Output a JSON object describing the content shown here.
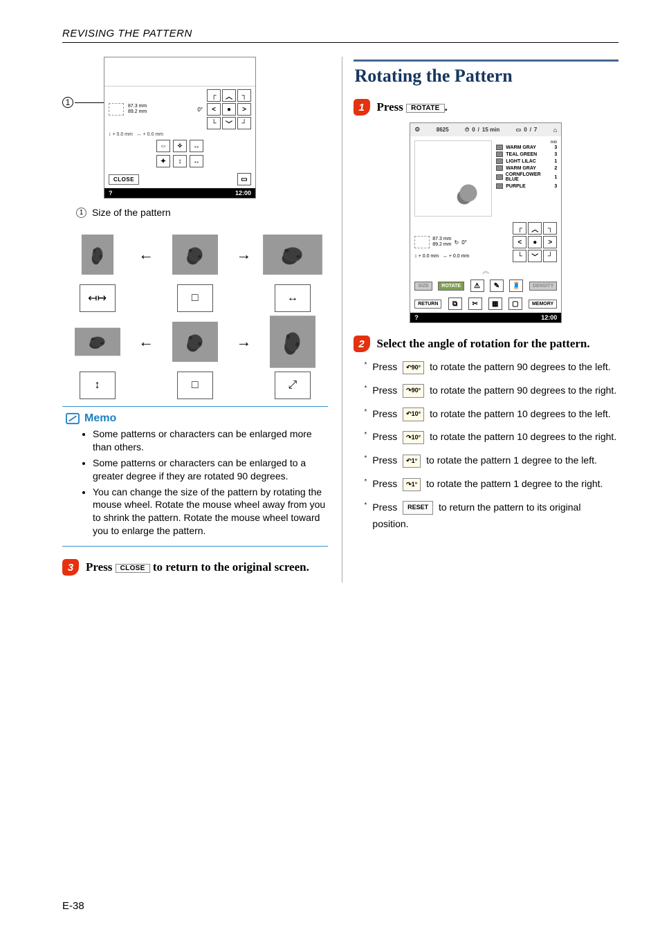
{
  "header": "REVISING THE PATTERN",
  "left": {
    "lcd_top": {
      "dims_h": "87.3 mm",
      "dims_w": "89.2 mm",
      "angle": "0°",
      "offset_v": "0.0 mm",
      "offset_h": "0.0 mm",
      "close_label": "CLOSE",
      "time": "12:00"
    },
    "callout_1": "1",
    "legend_1": "Size of the pattern",
    "memo": {
      "title": "Memo",
      "items": [
        "Some patterns or characters can be enlarged more than others.",
        "Some patterns or characters can be enlarged to a greater degree if they are rotated 90 degrees.",
        "You can change the size of the pattern by rotating the mouse wheel. Rotate the mouse wheel away from you to shrink the pattern. Rotate the mouse wheel toward you to enlarge the pattern."
      ]
    },
    "step3": {
      "num": "3",
      "pre": "Press ",
      "btn": "CLOSE",
      "post": " to return to the original screen."
    }
  },
  "right": {
    "heading": "Rotating the Pattern",
    "step1": {
      "num": "1",
      "pre": "Press ",
      "btn": "ROTATE",
      "post": "."
    },
    "lcd": {
      "stitch_count": "8625",
      "time_min": "0",
      "time_total": "15 min",
      "color_cur": "0",
      "color_total": "7",
      "threads_label": "min",
      "threads": [
        {
          "name": "WARM GRAY",
          "min": "3"
        },
        {
          "name": "TEAL GREEN",
          "min": "3"
        },
        {
          "name": "LIGHT LILAC",
          "min": "1"
        },
        {
          "name": "WARM GRAY",
          "min": "2"
        },
        {
          "name": "CORNFLOWER BLUE",
          "min": "1"
        },
        {
          "name": "PURPLE",
          "min": "3"
        }
      ],
      "dims_h": "87.3 mm",
      "dims_w": "89.2 mm",
      "angle": "0°",
      "offset_v": "0.0 mm",
      "offset_h": "0.0 mm",
      "size_btn": "SIZE",
      "rotate_btn": "ROTATE",
      "density_btn": "DENSITY",
      "return_btn": "RETURN",
      "memory_btn": "MEMORY",
      "time": "12:00"
    },
    "step2": {
      "num": "2",
      "text": "Select the angle of rotation for the pattern."
    },
    "rotations": [
      {
        "pre": "Press ",
        "btn": "90°",
        "post": " to rotate the pattern 90 degrees to the left.",
        "arrow": "↶"
      },
      {
        "pre": "Press ",
        "btn": "90°",
        "post": " to rotate the pattern 90 degrees to the right.",
        "arrow": "↷"
      },
      {
        "pre": "Press ",
        "btn": "10°",
        "post": " to rotate the pattern 10 degrees to the left.",
        "arrow": "↶"
      },
      {
        "pre": "Press ",
        "btn": "10°",
        "post": " to rotate the pattern 10 degrees to the right.",
        "arrow": "↷"
      },
      {
        "pre": "Press ",
        "btn": "1°",
        "post": " to rotate the pattern 1 degree to the left.",
        "arrow": "↶"
      },
      {
        "pre": "Press ",
        "btn": "1°",
        "post": " to rotate the pattern 1 degree to the right.",
        "arrow": "↷"
      },
      {
        "pre": "Press ",
        "btn": "RESET",
        "post": " to return the pattern to its original position.",
        "reset": true
      }
    ]
  },
  "page_number": "E-38"
}
